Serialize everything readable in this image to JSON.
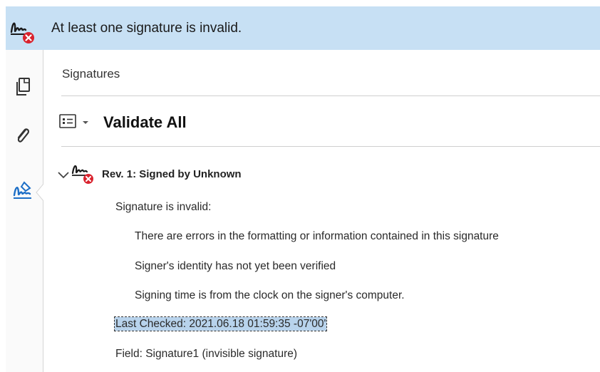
{
  "banner": {
    "message": "At least one signature is invalid.",
    "icon": "signature-invalid-icon",
    "color": "#c7e0f4"
  },
  "leftbar": {
    "tools": [
      {
        "name": "pages-icon"
      },
      {
        "name": "attachment-icon"
      },
      {
        "name": "signatures-icon",
        "active": true
      }
    ]
  },
  "panel": {
    "title": "Signatures",
    "validate_all_label": "Validate All",
    "revision": {
      "label": "Rev. 1: Signed by Unknown",
      "status": "Signature is invalid:",
      "details": [
        "There are errors in the formatting or information contained in this signature",
        "Signer's identity has not yet been verified",
        "Signing time is from the clock on the signer's computer."
      ],
      "last_checked": "Last Checked: 2021.06.18 01:59:35 -07'00'",
      "field": "Field: Signature1 (invisible signature)"
    }
  },
  "colors": {
    "error_red": "#d9232e",
    "highlight": "#b8d3ec"
  }
}
